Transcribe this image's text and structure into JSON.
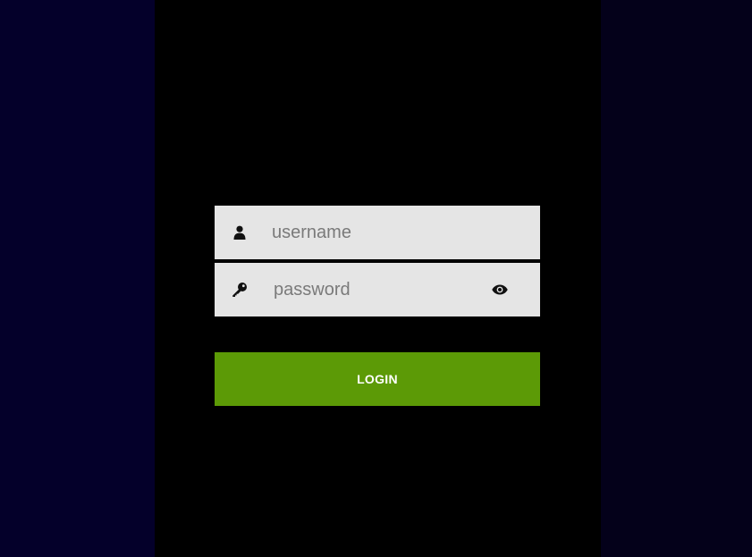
{
  "login_form": {
    "username": {
      "placeholder": "username",
      "value": "",
      "icon": "user-icon"
    },
    "password": {
      "placeholder": "password",
      "value": "",
      "icon": "key-icon",
      "toggle_icon": "eye-icon"
    },
    "submit_label": "LOGIN"
  },
  "colors": {
    "page_background": "#000000",
    "left_panel": "#04002a",
    "right_panel": "#04011a",
    "field_background": "#e5e5e5",
    "button_background": "#5c9a06",
    "button_text": "#ffffff"
  }
}
